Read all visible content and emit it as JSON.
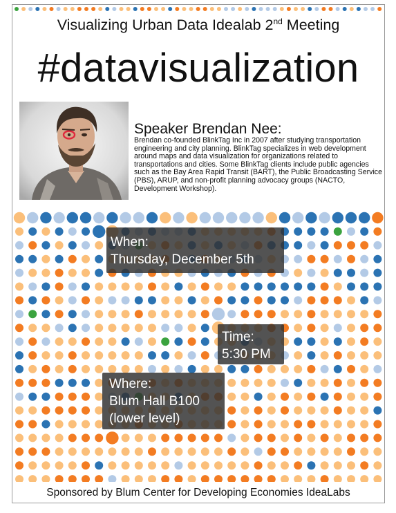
{
  "title_main": "Visualizing Urban Data Idealab 2",
  "title_sup": "nd",
  "title_rest": " Meeting",
  "hashtag": "#datavisualization",
  "speaker": {
    "heading": "Speaker Brendan Nee:",
    "bio": "Brendan co-founded BlinkTag Inc in 2007 after studying transportation engineering and city planning. BlinkTag specializes in web development around maps and data visualization for organizations related to transportations and cities.  Some BlinkTag clients include public agencies such as the Bay Area Rapid Transit (BART), the Public Broadcasting Service (PBS), ARUP, and non-profit planning advocacy groups (NACTO, Development Workshop)."
  },
  "when": {
    "label": "When:",
    "value": "Thursday, December 5th"
  },
  "time": {
    "label": "Time:",
    "value": "5:30 PM"
  },
  "where": {
    "label": "Where:",
    "line1": "Blum Hall B100",
    "line2": "(lower level)"
  },
  "sponsor": "Sponsored by Blum Center for Developing Economies IdeaLabs",
  "colors": {
    "dark_orange": "#f37c22",
    "light_orange": "#fbbf7a",
    "dark_blue": "#2b73b3",
    "light_blue": "#b3cae6",
    "green": "#3ba33f",
    "overlay": "#333333"
  }
}
